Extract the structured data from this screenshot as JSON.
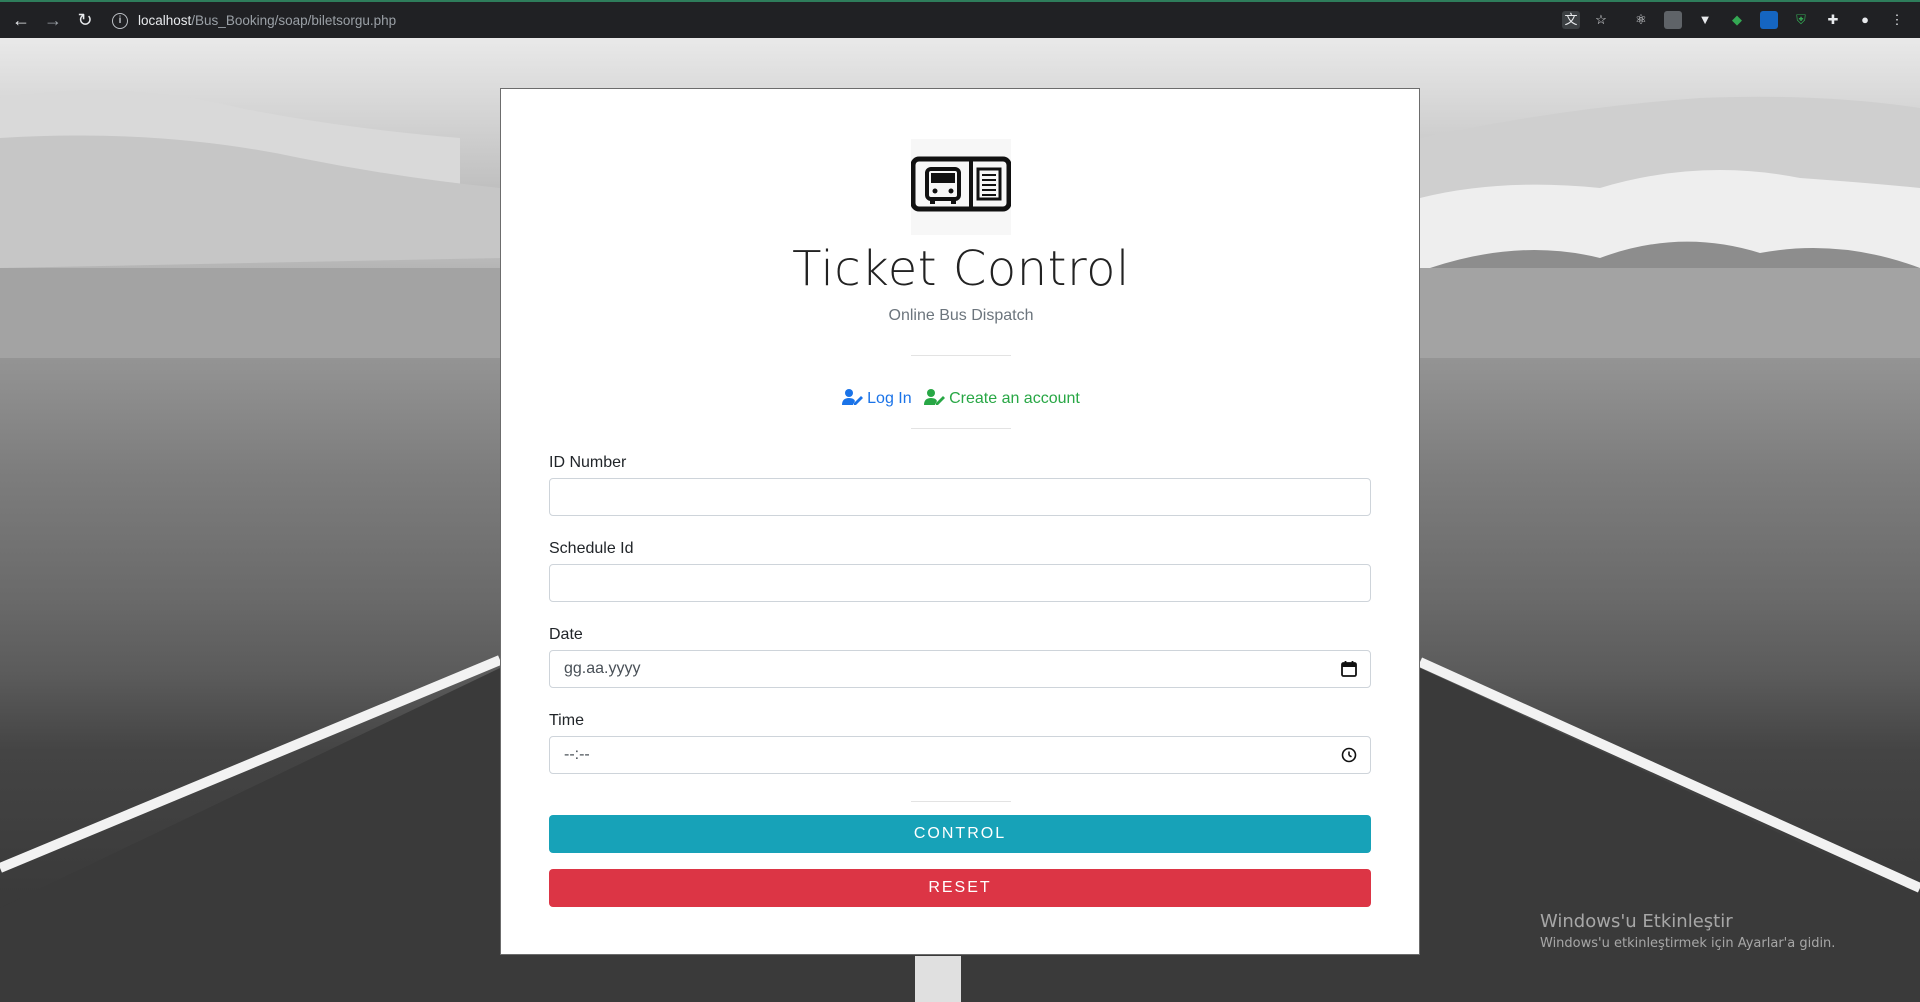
{
  "browser": {
    "url_host": "localhost",
    "url_path": "/Bus_Booking/soap/biletsorgu.php",
    "nav_icons": [
      "back-icon",
      "forward-icon",
      "reload-icon"
    ],
    "extension_icons": [
      "translate-icon",
      "bookmark-star-icon",
      "react-devtools-icon",
      "extension-square-icon",
      "vue-devtools-icon",
      "extension-green-icon",
      "extension-blue-icon",
      "shield-icon",
      "puzzle-icon",
      "profile-icon",
      "menu-dots-icon"
    ]
  },
  "card": {
    "logo_icon": "bus-ticket-icon",
    "title": "Ticket Control",
    "subtitle": "Online Bus Dispatch",
    "links": {
      "login": "Log In",
      "signup": "Create an account"
    },
    "fields": {
      "id_number": {
        "label": "ID Number",
        "value": ""
      },
      "schedule_id": {
        "label": "Schedule Id",
        "value": ""
      },
      "date": {
        "label": "Date",
        "placeholder": "gg.aa.yyyy"
      },
      "time": {
        "label": "Time",
        "placeholder": "--:--"
      }
    },
    "buttons": {
      "control": "CONTROL",
      "reset": "RESET"
    },
    "colors": {
      "control": "#17a2b8",
      "reset": "#dc3545",
      "login": "#1a73e8",
      "signup": "#28a745"
    }
  },
  "watermark": {
    "line1": "Windows'u Etkinleştir",
    "line2": "Windows'u etkinleştirmek için Ayarlar'a gidin."
  }
}
